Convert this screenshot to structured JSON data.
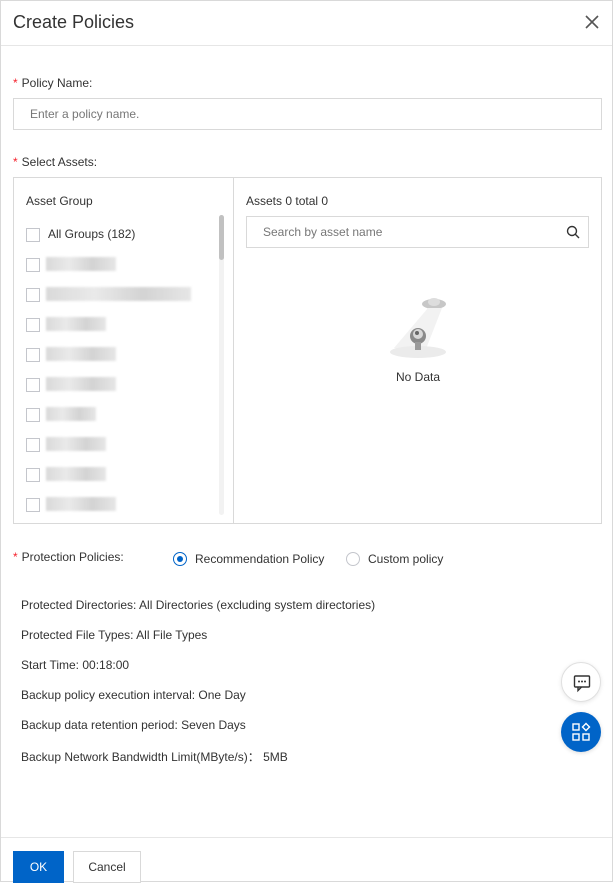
{
  "dialog": {
    "title": "Create Policies"
  },
  "policy_name": {
    "label": "Policy Name:",
    "required_mark": "*",
    "placeholder": "Enter a policy name.",
    "value": ""
  },
  "select_assets": {
    "label": "Select Assets:",
    "required_mark": "*",
    "asset_group_title": "Asset Group",
    "all_groups_label": "All Groups (182)",
    "assets_title": "Assets 0 total 0",
    "search_placeholder": "Search by asset name",
    "empty_text": "No Data"
  },
  "protection": {
    "label": "Protection Policies:",
    "required_mark": "*",
    "options": [
      {
        "label": "Recommendation Policy",
        "selected": true
      },
      {
        "label": "Custom policy",
        "selected": false
      }
    ]
  },
  "details": [
    "Protected Directories: All Directories (excluding system directories)",
    "Protected File Types: All File Types",
    "Start Time: 00:18:00",
    "Backup policy execution interval: One Day",
    "Backup data retention period: Seven Days",
    "Backup Network Bandwidth Limit(MByte/s)： 5MB"
  ],
  "footer": {
    "ok_label": "OK",
    "cancel_label": "Cancel"
  },
  "colors": {
    "primary": "#0064c8",
    "required": "#f5222d",
    "border": "#d9d9d9"
  },
  "icons": {
    "close": "close-icon",
    "search": "search-icon",
    "chat": "chat-icon",
    "apps": "apps-icon"
  }
}
